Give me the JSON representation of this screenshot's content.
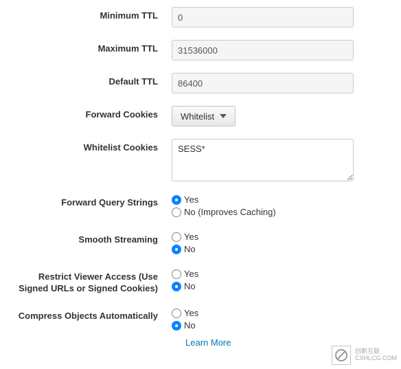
{
  "fields": {
    "min_ttl": {
      "label": "Minimum TTL",
      "value": "0"
    },
    "max_ttl": {
      "label": "Maximum TTL",
      "value": "31536000"
    },
    "default_ttl": {
      "label": "Default TTL",
      "value": "86400"
    },
    "forward_cookies": {
      "label": "Forward Cookies",
      "selected": "Whitelist"
    },
    "whitelist_cookies": {
      "label": "Whitelist Cookies",
      "value": "SESS*"
    },
    "forward_qs": {
      "label": "Forward Query Strings",
      "yes": "Yes",
      "no": "No (Improves Caching)",
      "selected": "yes"
    },
    "smooth_streaming": {
      "label": "Smooth Streaming",
      "yes": "Yes",
      "no": "No",
      "selected": "no"
    },
    "restrict_viewer": {
      "label": "Restrict Viewer Access (Use Signed URLs or Signed Cookies)",
      "yes": "Yes",
      "no": "No",
      "selected": "no"
    },
    "compress": {
      "label": "Compress Objects Automatically",
      "yes": "Yes",
      "no": "No",
      "selected": "no",
      "learn_more": "Learn More"
    }
  },
  "watermark": {
    "line1": "创新互联",
    "line2": "CXHLCG.COM"
  }
}
